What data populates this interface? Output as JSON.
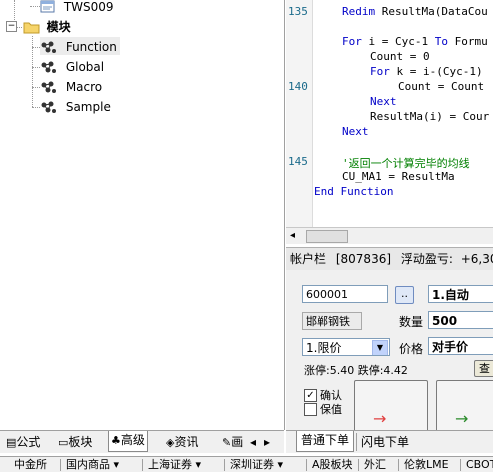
{
  "tree": {
    "top_item": "TWS009",
    "group": "模块",
    "items": [
      "Function",
      "Global",
      "Macro",
      "Sample"
    ]
  },
  "left_tabs": [
    "公式",
    "板块",
    "高级",
    "资讯",
    "画"
  ],
  "code": {
    "lines": [
      {
        "num": "135",
        "text": "Redim ResultMa(DataCou",
        "indent": 1,
        "kind": "kw-first"
      },
      {
        "num": "",
        "text": "",
        "indent": 0,
        "kind": "plain"
      },
      {
        "num": "",
        "text": "For i = Cyc-1 To Formu",
        "indent": 1,
        "kind": "for"
      },
      {
        "num": "",
        "text": "Count = 0",
        "indent": 2,
        "kind": "plain"
      },
      {
        "num": "",
        "text": "For k = i-(Cyc-1)",
        "indent": 2,
        "kind": "for"
      },
      {
        "num": "140",
        "text": "Count = Count",
        "indent": 3,
        "kind": "plain"
      },
      {
        "num": "",
        "text": "Next",
        "indent": 2,
        "kind": "kw"
      },
      {
        "num": "",
        "text": "ResultMa(i) = Cour",
        "indent": 2,
        "kind": "plain"
      },
      {
        "num": "",
        "text": "Next",
        "indent": 1,
        "kind": "kw"
      },
      {
        "num": "",
        "text": "",
        "indent": 0,
        "kind": "plain"
      },
      {
        "num": "145",
        "text": "'返回一个计算完毕的均线",
        "indent": 1,
        "kind": "comment"
      },
      {
        "num": "",
        "text": "CU_MA1 = ResultMa",
        "indent": 1,
        "kind": "plain"
      },
      {
        "num": "",
        "text": "End Function",
        "indent": 0,
        "kind": "kw"
      }
    ]
  },
  "account": {
    "label": "帐户栏",
    "id": "[807836]",
    "float_label": "浮动盈亏:",
    "float_value": "+6,30"
  },
  "order": {
    "code_value": "600001",
    "browse_label": "..",
    "mode_value": "1.自动",
    "stock_name": "邯郸钢铁",
    "qty_label": "数量",
    "qty_value": "500",
    "price_type_value": "1.限价",
    "price_label": "价格",
    "price_value": "对手价",
    "limit_text": "涨停:5.40 跌停:4.42",
    "query_label": "查",
    "confirm_label": "确认",
    "keep_label": "保值"
  },
  "right_tabs": [
    "普通下单",
    "闪电下单"
  ],
  "market_tabs": [
    "中金所",
    "国内商品",
    "上海证券",
    "深圳证券",
    "A股板块",
    "外汇",
    "伦敦LME",
    "CBOT"
  ],
  "colors": {
    "keyword": "#0000c8",
    "comment": "#008000",
    "line_number": "#1a6a8a",
    "sell_red": "#cc0000"
  }
}
